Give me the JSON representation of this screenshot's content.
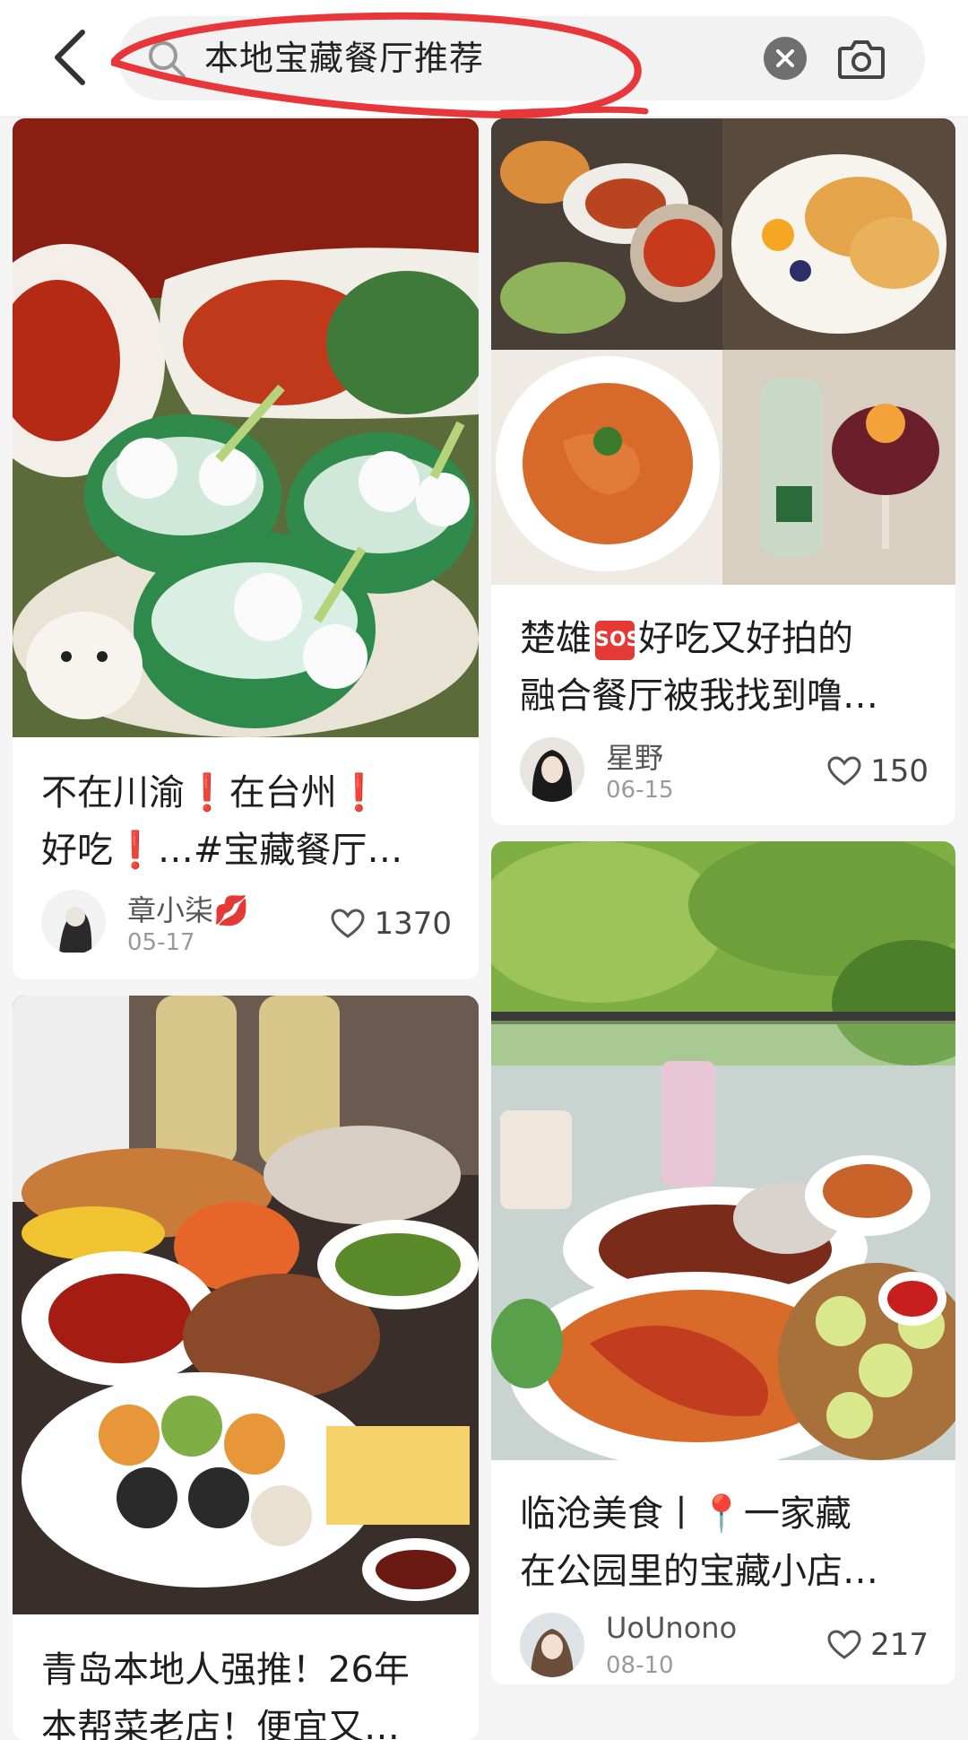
{
  "search": {
    "query": "本地宝藏餐厅推荐"
  },
  "icons": {
    "back": "chevron-left-icon",
    "search": "search-icon",
    "clear": "close-circle-icon",
    "camera": "camera-icon",
    "like": "heart-outline-icon"
  },
  "colors": {
    "annotation": "#e8373a",
    "accent": "#e53935"
  },
  "cards": [
    {
      "title_line1": [
        "不在川渝",
        "❗",
        "在台州",
        "❗"
      ],
      "title_line2": [
        "好吃",
        "❗",
        "…#宝藏餐厅…"
      ],
      "author": "章小柒",
      "author_emoji": "💋",
      "date": "05-17",
      "likes": "1370"
    },
    {
      "title_line1": [
        "楚雄",
        "SOS",
        "好吃又好拍的"
      ],
      "title_line2": "融合餐厅被我找到噜…",
      "author": "星野",
      "date": "06-15",
      "likes": "150"
    },
    {
      "title_line1": [
        "临沧美食丨",
        "📍",
        "一家藏"
      ],
      "title_line2": "在公园里的宝藏小店…",
      "author": "UoUnono",
      "date": "08-10",
      "likes": "217"
    },
    {
      "title_line1": "青岛本地人强推！26年",
      "title_line2": "本帮菜老店！便宜又…"
    }
  ]
}
